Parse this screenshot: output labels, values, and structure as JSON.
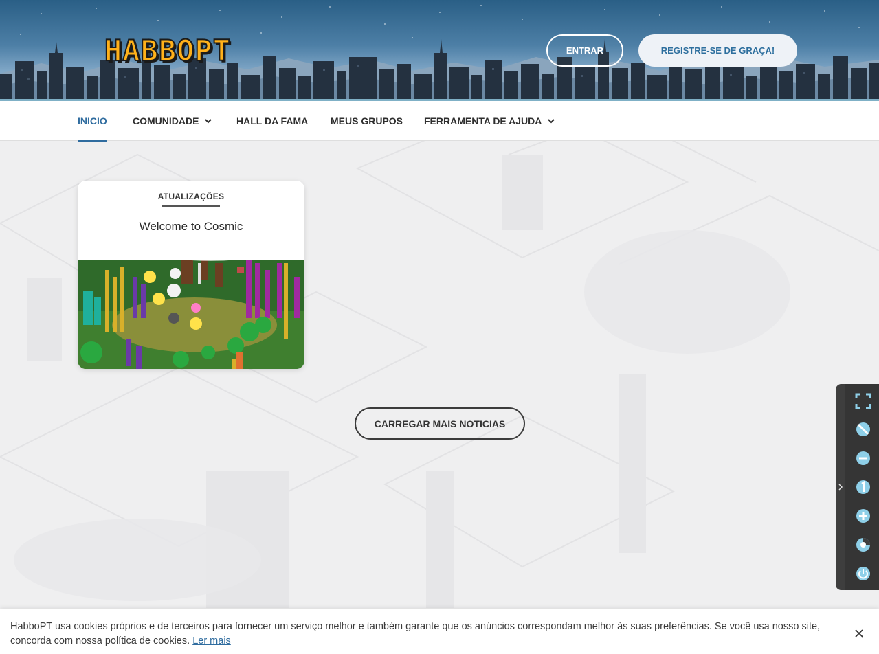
{
  "header": {
    "logo_text": "HABBOPT",
    "login_label": "ENTRAR",
    "register_label": "REGISTRE-SE DE GRAÇA!"
  },
  "nav": {
    "items": [
      {
        "label": "INICIO",
        "active": true,
        "dropdown": false
      },
      {
        "label": "COMUNIDADE",
        "active": false,
        "dropdown": true
      },
      {
        "label": "HALL DA FAMA",
        "active": false,
        "dropdown": false
      },
      {
        "label": "MEUS GRUPOS",
        "active": false,
        "dropdown": false
      },
      {
        "label": "FERRAMENTA DE AJUDA",
        "active": false,
        "dropdown": true
      }
    ]
  },
  "news": {
    "category": "ATUALIZAÇÕES",
    "title": "Welcome to Cosmic"
  },
  "load_more_label": "CARREGAR MAIS NOTICIAS",
  "toolbar": {
    "icons": [
      "fullscreen-icon",
      "disable-icon",
      "zoom-out-icon",
      "zoom-reset-icon",
      "zoom-in-icon",
      "rotate-icon",
      "power-icon"
    ]
  },
  "cookie": {
    "text": "HabboPT usa cookies próprios e de terceiros para fornecer um serviço melhor e também garante que os anúncios correspondam melhor às suas preferências. Se você usa nosso site, concorda com nossa política de cookies.",
    "link_label": "Ler mais"
  },
  "colors": {
    "accent": "#2f6c9f",
    "logo": "#ffb11a",
    "toolbar_icon": "#8ecfe8"
  }
}
